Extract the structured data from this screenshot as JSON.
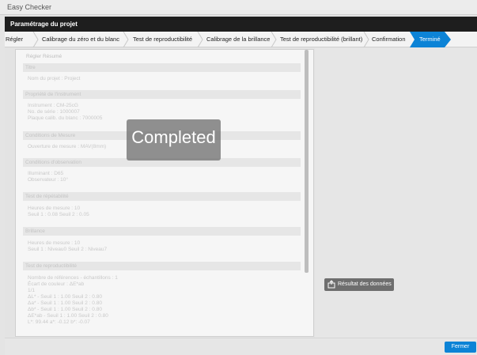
{
  "app": {
    "title": "Easy Checker"
  },
  "header": {
    "title": "Paramétrage du projet"
  },
  "tabs": [
    {
      "label": "Régler"
    },
    {
      "label": "Calibrage du zéro et du blanc"
    },
    {
      "label": "Test de reproductibilité"
    },
    {
      "label": "Calibrage de la brillance"
    },
    {
      "label": "Test de reproductibilité (brillant)"
    },
    {
      "label": "Confirmation"
    },
    {
      "label": "Terminé"
    }
  ],
  "summary": {
    "heading": "Régler Résumé",
    "sections": [
      {
        "title": "Titre",
        "lines": [
          "Nom du projet : Project"
        ]
      },
      {
        "title": "Propriété de l'instrument",
        "lines": [
          "Instrument : CM-25cG",
          "No. de série : 1000007",
          "Plaque calib. du blanc : 7000005"
        ]
      },
      {
        "title": "Conditions de Mesure",
        "lines": [
          "Ouverture de mesure : MAV(8mm)"
        ]
      },
      {
        "title": "Conditions d'observation",
        "lines": [
          "Illuminant : D65",
          "Observateur : 10°"
        ]
      },
      {
        "title": "Test de répétabilité",
        "lines": [
          "Heures de mesure : 10",
          "Seuil 1 : 0.08  Seuil 2 : 0.05"
        ]
      },
      {
        "title": "Brillance",
        "lines": [
          "Heures de mesure : 10",
          "Seuil 1 : Niveau0  Seuil 2 : Niveau7"
        ]
      },
      {
        "title": "Test de reproductibilité",
        "lines": [
          "Nombre de références - échantillons : 1",
          "Écart de couleur : ΔE*ab",
          "1/1",
          "ΔL* - Seuil 1 : 1.00  Seuil 2 : 0.80",
          "Δa* - Seuil 1 : 1.00  Seuil 2 : 0.80",
          "Δb* - Seuil 1 : 1.00  Seuil 2 : 0.80",
          "ΔE*ab - Seuil 1 : 1.00  Seuil 2 : 0.80",
          "L*: 99.44  a*: -0.12  b*: -0.07"
        ]
      }
    ]
  },
  "overlay": {
    "text": "Completed"
  },
  "right": {
    "result_button_label": "Résultat des données",
    "result_icon": "export-data-icon"
  },
  "footer": {
    "close_label": "Fermer"
  },
  "colors": {
    "header_bg": "#1e1e1e",
    "active_tab": "#0c83d6",
    "close_button": "#0c83d6",
    "result_button": "#6e6e6e"
  }
}
